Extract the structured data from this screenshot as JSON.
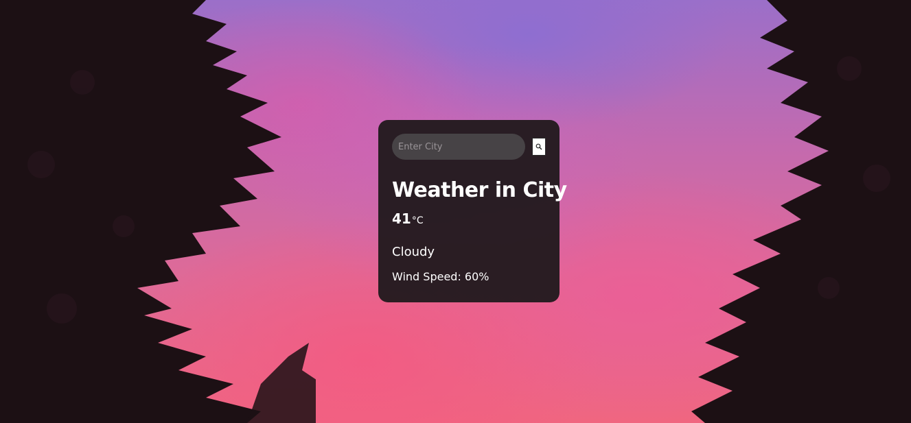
{
  "search": {
    "placeholder": "Enter City",
    "value": "",
    "button_icon": "search-icon"
  },
  "weather": {
    "title": "Weather in City",
    "temperature": "41",
    "unit": "°C",
    "condition": "Cloudy",
    "wind": "Wind Speed: 60%"
  },
  "colors": {
    "card_background": "#221a1e",
    "input_background": "#474346",
    "text": "#ffffff"
  }
}
